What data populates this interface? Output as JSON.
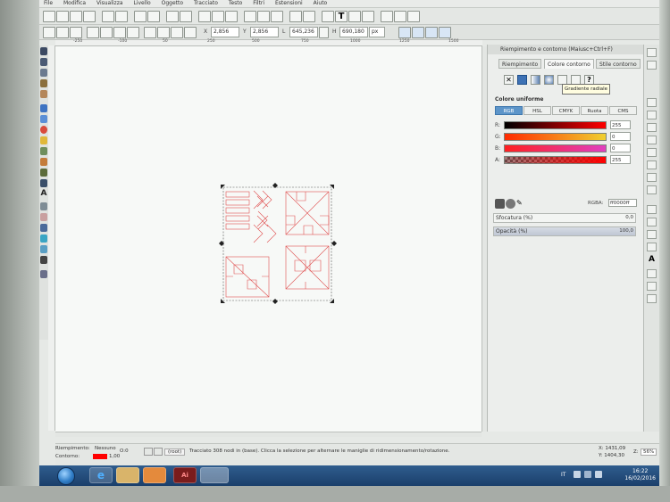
{
  "menu": [
    "File",
    "Modifica",
    "Visualizza",
    "Livello",
    "Oggetto",
    "Tracciato",
    "Testo",
    "Filtri",
    "Estensioni",
    "Aiuto"
  ],
  "toolbar": {
    "x_label": "X",
    "x_value": "2,856",
    "y_label": "Y",
    "y_value": "2,856",
    "w_label": "L",
    "w_value": "645,236",
    "h_label": "H",
    "h_value": "690,180",
    "unit": "px"
  },
  "ruler_ticks": [
    "-250",
    "-100",
    "50",
    "250",
    "500",
    "750",
    "1000",
    "1250",
    "1500"
  ],
  "panel": {
    "title": "Riempimento e contorno (Maiusc+Ctrl+F)",
    "tabs": [
      "Riempimento",
      "Colore contorno",
      "Stile contorno"
    ],
    "active_tab": "Colore contorno",
    "tooltip": "Gradiente radiale",
    "uniform_label": "Colore uniforme",
    "mode_tabs": [
      "RGB",
      "HSL",
      "CMYK",
      "Ruota",
      "CMS"
    ],
    "active_mode": "RGB",
    "channels": [
      {
        "label": "R:",
        "value": "255",
        "level": 1.0,
        "colors": [
          "#000000",
          "#ff0000"
        ]
      },
      {
        "label": "G:",
        "value": "0",
        "level": 0.0,
        "colors": [
          "#ff0000",
          "#ffff00"
        ]
      },
      {
        "label": "B:",
        "value": "0",
        "level": 0.0,
        "colors": [
          "#ff0000",
          "#ff00ff"
        ]
      },
      {
        "label": "A:",
        "value": "255",
        "level": 1.0,
        "colors": [
          "#7a1010",
          "#ff0000"
        ]
      }
    ],
    "rgba_label": "RGBA:",
    "rgba_value": "ff0000ff",
    "blur_label": "Sfocatura (%)",
    "blur_value": "0,0",
    "opacity_label": "Opacità (%)",
    "opacity_value": "100,0"
  },
  "statusbar": {
    "fill_label": "Riempimento:",
    "stroke_label": "Contorno:",
    "none_label": "Nessuno",
    "stroke_width": "1,00",
    "opacity_mode": "O:0",
    "layer": "(root)",
    "message": "Tracciato 308 nodi in (base). Clicca la selezione per alternare le maniglie di ridimensionamento/rotazione.",
    "coords_x": "X: 1431,09",
    "coords_y": "Y: 1404,30",
    "zoom_label": "Z:",
    "zoom_value": "56%"
  },
  "taskbar": {
    "language": "IT",
    "time": "16:22",
    "date": "16/02/2016"
  },
  "colors": {
    "accent": "#5d95c9",
    "stroke": "#ff0000",
    "taskbar": "#1b3f6b"
  }
}
